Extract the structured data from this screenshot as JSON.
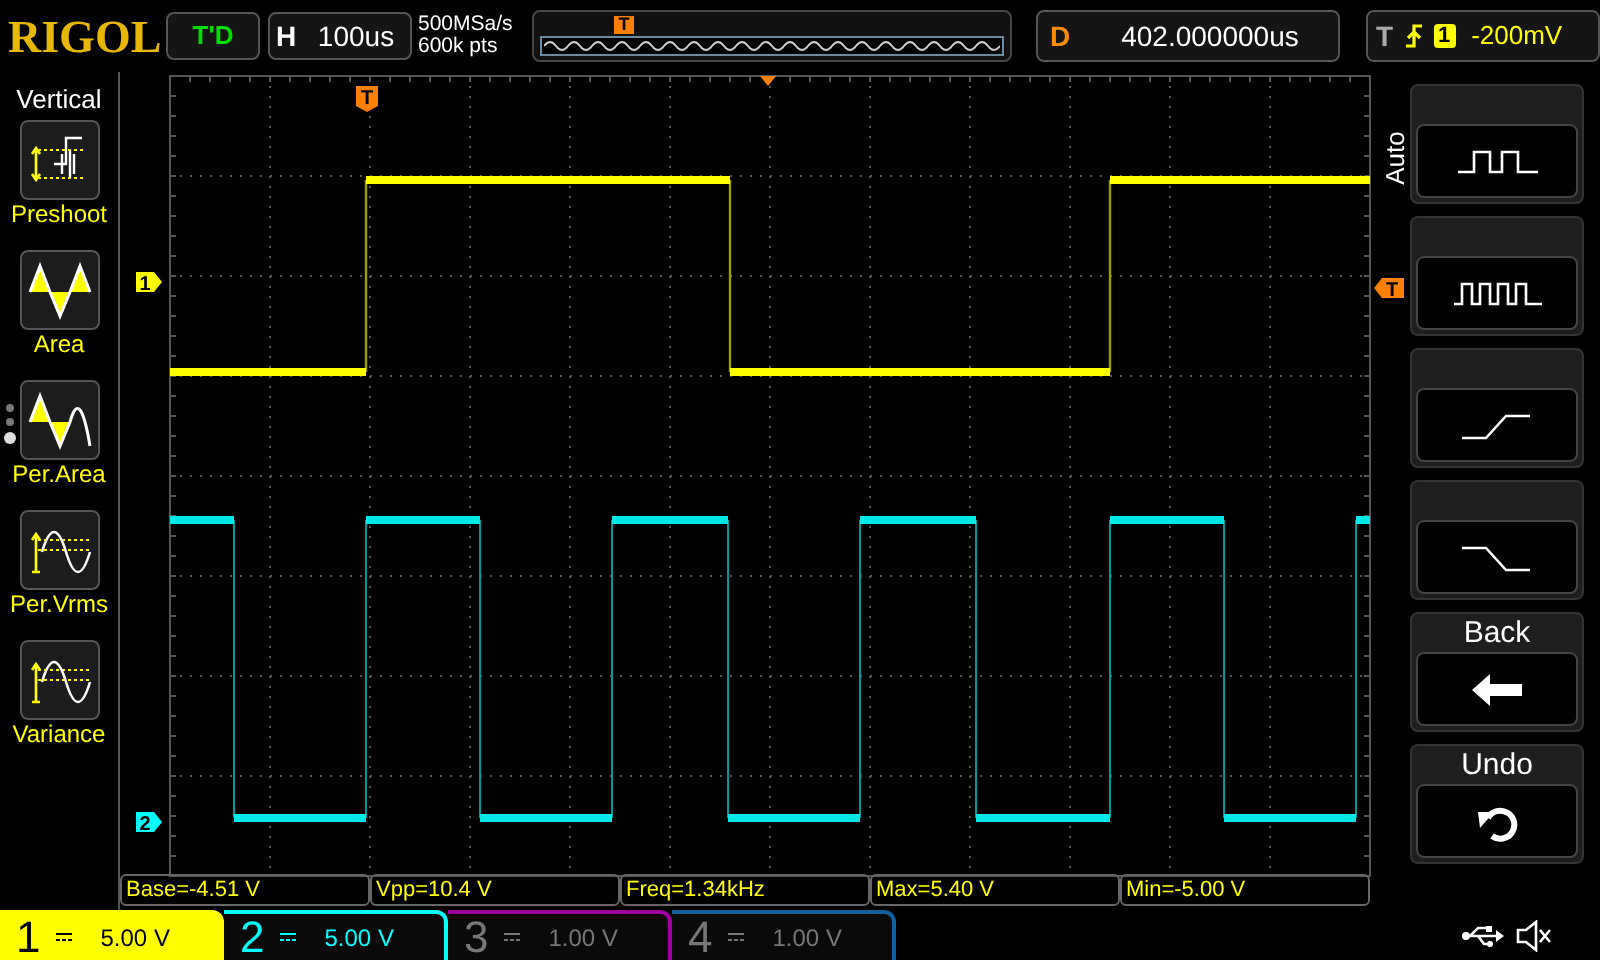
{
  "logo": "RIGOL",
  "run_state": "T'D",
  "horizontal": {
    "label": "H",
    "timebase": "100us"
  },
  "acquisition": {
    "sample_rate": "500MSa/s",
    "memory_depth": "600k pts"
  },
  "delay": {
    "label": "D",
    "value": "402.000000us"
  },
  "trigger": {
    "label": "T",
    "source": "1",
    "level": "-200mV"
  },
  "menu": {
    "title": "Vertical",
    "page_dots": [
      {
        "selected": false
      },
      {
        "selected": false
      },
      {
        "selected": true
      }
    ],
    "items": [
      {
        "kind": "preshoot",
        "label": "Preshoot"
      },
      {
        "kind": "area",
        "label": "Area"
      },
      {
        "kind": "per_area",
        "label": "Per.Area"
      },
      {
        "kind": "per_vrms",
        "label": "Per.Vrms"
      },
      {
        "kind": "variance",
        "label": "Variance"
      }
    ]
  },
  "markers": {
    "memory_trigger": "T",
    "ch1": "1",
    "ch2": "2",
    "trigger": "T",
    "trigger_level": "T"
  },
  "side_menu": {
    "label": "Auto",
    "buttons": [
      {
        "kind": "pulse"
      },
      {
        "kind": "pulses"
      },
      {
        "kind": "rise"
      },
      {
        "kind": "fall"
      },
      {
        "kind": "back",
        "label": "Back"
      },
      {
        "kind": "undo",
        "label": "Undo"
      }
    ]
  },
  "measurements": [
    "Base=-4.51 V",
    "Vpp=10.4 V",
    "Freq=1.34kHz",
    "Max=5.40 V",
    "Min=-5.00 V"
  ],
  "channels": [
    {
      "number": "1",
      "scale": "5.00 V",
      "enabled": true,
      "selected": true,
      "color": "#ffff00"
    },
    {
      "number": "2",
      "scale": "5.00 V",
      "enabled": true,
      "selected": false,
      "color": "#00ffff"
    },
    {
      "number": "3",
      "scale": "1.00 V",
      "enabled": false,
      "selected": false,
      "color": "#a000a0"
    },
    {
      "number": "4",
      "scale": "1.00 V",
      "enabled": false,
      "selected": false,
      "color": "#1060a0"
    }
  ]
}
